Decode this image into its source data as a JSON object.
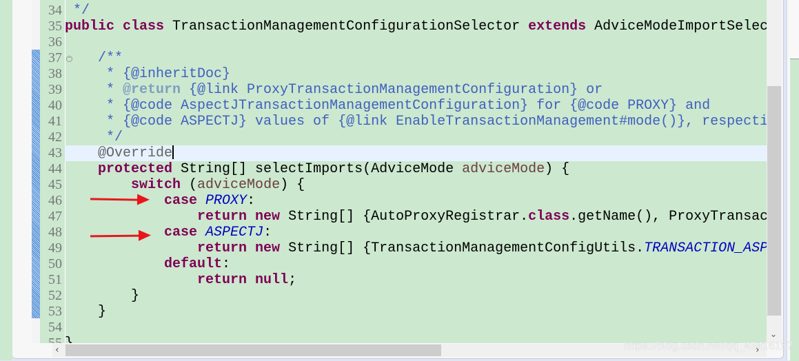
{
  "editor": {
    "first_line": 34,
    "current_line": 43,
    "lines": [
      {
        "n": "34",
        "tokens": [
          {
            "t": " */",
            "c": "jd"
          }
        ]
      },
      {
        "n": "35",
        "tokens": [
          {
            "t": "public class ",
            "c": "kw"
          },
          {
            "t": "TransactionManagementConfigurationSelector ",
            "c": "pl"
          },
          {
            "t": "extends ",
            "c": "kw"
          },
          {
            "t": "AdviceModeImportSelector<EnableTransactionManagement> {",
            "c": "pl"
          }
        ]
      },
      {
        "n": "36",
        "tokens": []
      },
      {
        "n": "37",
        "fold": true,
        "tokens": [
          {
            "t": "    /**",
            "c": "jd"
          }
        ]
      },
      {
        "n": "38",
        "tokens": [
          {
            "t": "     * {@inheritDoc}",
            "c": "jd"
          }
        ]
      },
      {
        "n": "39",
        "tokens": [
          {
            "t": "     * ",
            "c": "jd"
          },
          {
            "t": "@return",
            "c": "jt"
          },
          {
            "t": " {@link ProxyTransactionManagementConfiguration} or",
            "c": "jd"
          }
        ]
      },
      {
        "n": "40",
        "tokens": [
          {
            "t": "     * {@code AspectJTransactionManagementConfiguration} for {@code PROXY} and",
            "c": "jd"
          }
        ]
      },
      {
        "n": "41",
        "tokens": [
          {
            "t": "     * {@code ASPECTJ} values of {@link EnableTransactionManagement#mode()}, respectively",
            "c": "jd"
          }
        ]
      },
      {
        "n": "42",
        "tokens": [
          {
            "t": "     */",
            "c": "jd"
          }
        ]
      },
      {
        "n": "43",
        "fold": true,
        "tokens": [
          {
            "t": "    @Override",
            "c": "an"
          }
        ]
      },
      {
        "n": "44",
        "tokens": [
          {
            "t": "    protected ",
            "c": "kw"
          },
          {
            "t": "String[] selectImports(AdviceMode ",
            "c": "pl"
          },
          {
            "t": "adviceMode",
            "c": "lv"
          },
          {
            "t": ") {",
            "c": "pl"
          }
        ]
      },
      {
        "n": "45",
        "tokens": [
          {
            "t": "        switch ",
            "c": "kw"
          },
          {
            "t": "(",
            "c": "pl"
          },
          {
            "t": "adviceMode",
            "c": "lv"
          },
          {
            "t": ") {",
            "c": "pl"
          }
        ]
      },
      {
        "n": "46",
        "tokens": [
          {
            "t": "            case ",
            "c": "kw"
          },
          {
            "t": "PROXY",
            "c": "st"
          },
          {
            "t": ":",
            "c": "pl"
          }
        ]
      },
      {
        "n": "47",
        "tokens": [
          {
            "t": "                return new ",
            "c": "kw"
          },
          {
            "t": "String[] {AutoProxyRegistrar.",
            "c": "pl"
          },
          {
            "t": "class",
            "c": "kw"
          },
          {
            "t": ".getName(), ProxyTransactionManagementConfiguration.",
            "c": "pl"
          }
        ]
      },
      {
        "n": "48",
        "tokens": [
          {
            "t": "            case ",
            "c": "kw"
          },
          {
            "t": "ASPECTJ",
            "c": "st"
          },
          {
            "t": ":",
            "c": "pl"
          }
        ]
      },
      {
        "n": "49",
        "tokens": [
          {
            "t": "                return new ",
            "c": "kw"
          },
          {
            "t": "String[] {TransactionManagementConfigUtils.",
            "c": "pl"
          },
          {
            "t": "TRANSACTION_ASPECT_CONFIGURATION_CLASS_NAME",
            "c": "st"
          }
        ]
      },
      {
        "n": "50",
        "tokens": [
          {
            "t": "            default",
            "c": "kw"
          },
          {
            "t": ":",
            "c": "pl"
          }
        ]
      },
      {
        "n": "51",
        "tokens": [
          {
            "t": "                return null",
            "c": "kw"
          },
          {
            "t": ";",
            "c": "pl"
          }
        ]
      },
      {
        "n": "52",
        "tokens": [
          {
            "t": "        }",
            "c": "pl"
          }
        ]
      },
      {
        "n": "53",
        "tokens": [
          {
            "t": "    }",
            "c": "pl"
          }
        ]
      },
      {
        "n": "54",
        "tokens": []
      },
      {
        "n": "55",
        "tokens": [
          {
            "t": "}",
            "c": "pl"
          }
        ]
      }
    ]
  },
  "annotations": {
    "arrow_color": "#e8161c",
    "arrow_lines": [
      "46",
      "48"
    ]
  },
  "scrollbars": {
    "vertical_position_percent": 25,
    "horizontal_position_percent": 0
  },
  "watermark": "https://blog.csdn.net/qq_43416157",
  "colors": {
    "background": "#cce8cf",
    "current_line": "#e8f2fe",
    "keyword": "#7f0055",
    "javadoc": "#3f5fbf",
    "static_field": "#0000c0"
  }
}
